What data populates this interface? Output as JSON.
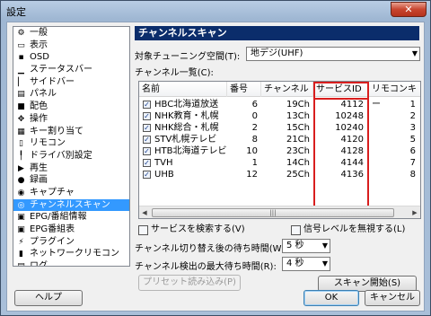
{
  "window": {
    "title": "設定",
    "close_glyph": "✕"
  },
  "tree": {
    "items": [
      {
        "label": "一般",
        "icon": "gear-icon",
        "glyph": "⚙"
      },
      {
        "label": "表示",
        "icon": "display-icon",
        "glyph": "▭"
      },
      {
        "label": "OSD",
        "icon": "osd-icon",
        "glyph": "▪"
      },
      {
        "label": "ステータスバー",
        "icon": "statusbar-icon",
        "glyph": "▁"
      },
      {
        "label": "サイドバー",
        "icon": "sidebar-icon",
        "glyph": "▏"
      },
      {
        "label": "パネル",
        "icon": "panel-icon",
        "glyph": "▤"
      },
      {
        "label": "配色",
        "icon": "palette-icon",
        "glyph": "■"
      },
      {
        "label": "操作",
        "icon": "operation-icon",
        "glyph": "✥"
      },
      {
        "label": "キー割り当て",
        "icon": "keyboard-icon",
        "glyph": "▦"
      },
      {
        "label": "リモコン",
        "icon": "remote-icon",
        "glyph": "▯"
      },
      {
        "label": "ドライバ別設定",
        "icon": "driver-icon",
        "glyph": "╿"
      },
      {
        "label": "再生",
        "icon": "play-icon",
        "glyph": "▶"
      },
      {
        "label": "録画",
        "icon": "record-icon",
        "glyph": "●"
      },
      {
        "label": "キャプチャ",
        "icon": "camera-icon",
        "glyph": "◉"
      },
      {
        "label": "チャンネルスキャン",
        "icon": "scan-icon",
        "glyph": "◎"
      },
      {
        "label": "EPG/番組情報",
        "icon": "epg-icon",
        "glyph": "▣"
      },
      {
        "label": "EPG番組表",
        "icon": "epg-table-icon",
        "glyph": "▣"
      },
      {
        "label": "プラグイン",
        "icon": "plugin-icon",
        "glyph": "⚡"
      },
      {
        "label": "ネットワークリモコン",
        "icon": "network-remote-icon",
        "glyph": "▮"
      },
      {
        "label": "ログ",
        "icon": "log-icon",
        "glyph": "▤"
      }
    ],
    "selected_index": 14
  },
  "panel": {
    "title": "チャンネルスキャン",
    "tuning_space_label": "対象チューニング空間(T):",
    "tuning_space_value": "地デジ(UHF)",
    "channel_list_label": "チャンネル一覧(C):",
    "columns": [
      "名前",
      "番号",
      "チャンネル",
      "サービスID",
      "リモコンキー"
    ],
    "rows": [
      {
        "name": "HBC北海道放送",
        "number": "6",
        "channel": "19Ch",
        "service_id": "4112",
        "remote_key": "1"
      },
      {
        "name": "NHK教育・札幌",
        "number": "0",
        "channel": "13Ch",
        "service_id": "10248",
        "remote_key": "2"
      },
      {
        "name": "NHK総合・札幌",
        "number": "2",
        "channel": "15Ch",
        "service_id": "10240",
        "remote_key": "3"
      },
      {
        "name": "STV札幌テレビ",
        "number": "8",
        "channel": "21Ch",
        "service_id": "4120",
        "remote_key": "5"
      },
      {
        "name": "HTB北海道テレビ",
        "number": "10",
        "channel": "23Ch",
        "service_id": "4128",
        "remote_key": "6"
      },
      {
        "name": "TVH",
        "number": "1",
        "channel": "14Ch",
        "service_id": "4144",
        "remote_key": "7"
      },
      {
        "name": "UHB",
        "number": "12",
        "channel": "25Ch",
        "service_id": "4136",
        "remote_key": "8"
      }
    ],
    "scroll_thumb_glyph": "|||",
    "scroll_left_glyph": "◀",
    "scroll_right_glyph": "▶",
    "search_service_label": "サービスを検索する(V)",
    "ignore_signal_label": "信号レベルを無視する(L)",
    "wait_after_switch_label": "チャンネル切り替え後の待ち時間(W):",
    "wait_after_switch_value": "5 秒",
    "max_detect_wait_label": "チャンネル検出の最大待ち時間(R):",
    "max_detect_wait_value": "4 秒",
    "preset_load_label": "プリセット読み込み(P)",
    "scan_start_label": "スキャン開始(S)",
    "check_glyph": "✓",
    "arrow_glyph": "▼"
  },
  "footer": {
    "help_label": "ヘルプ",
    "ok_label": "OK",
    "cancel_label": "キャンセル"
  },
  "colors": {
    "highlight": "#d81e1e",
    "selection": "#3399ff",
    "header_bg": "#0b2d6b"
  }
}
